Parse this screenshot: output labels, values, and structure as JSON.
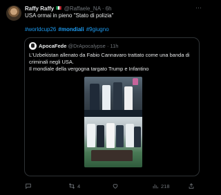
{
  "author": {
    "name": "Raffy Raffy",
    "flag_icon": "italy-flag-icon",
    "handle": "@Raffaele_NA",
    "time": "· 6h"
  },
  "tweet": {
    "text": "USA ormai in pieno \"Stato di polizia\"",
    "hashtags": [
      "#worldcup26",
      "#mondiali",
      "#9giugno"
    ]
  },
  "quote": {
    "name": "ApocaFede",
    "handle": "@DrApocalypse",
    "time": "· 11h",
    "line1": "L'Uzbekistan allenato da Fabio Cannavaro trattato come una banda di criminali negli USA.",
    "line2": "Il mondiale della vergogna targato Trump e Infantino"
  },
  "actions": {
    "reply_count": "",
    "retweet_count": "4",
    "like_count": "",
    "views_count": "218"
  },
  "colors": {
    "background": "#000000",
    "text": "#e7e9ea",
    "muted": "#71767b",
    "accent": "#1d9bf0",
    "border": "#2f3336"
  }
}
